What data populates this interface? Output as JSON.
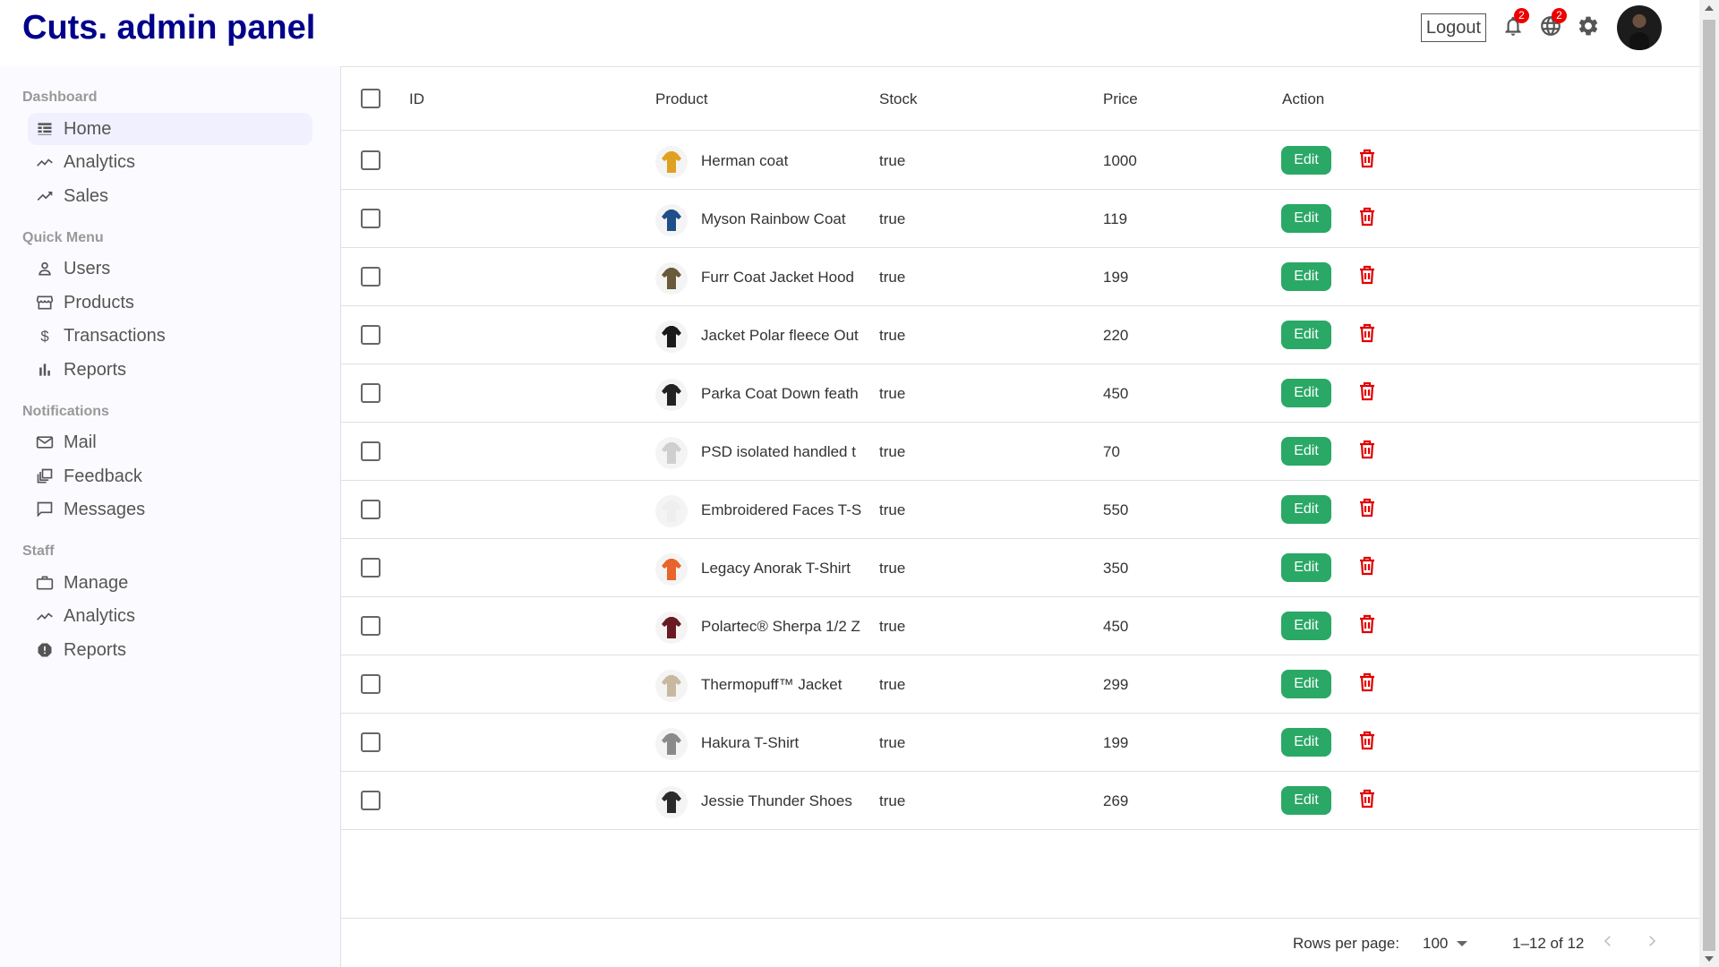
{
  "app": {
    "title": "Cuts. admin panel",
    "logout_label": "Logout",
    "notifications_count": "2",
    "language_count": "2",
    "icons": {
      "notifications": "bell-icon",
      "language": "globe-icon",
      "settings": "gear-icon"
    }
  },
  "colors": {
    "brand": "#00008b",
    "edit_button": "#2aa866",
    "delete_icon": "#e00000",
    "badge": "#ee0000",
    "active_nav_bg": "#f0f0ff"
  },
  "sidebar": {
    "sections": [
      {
        "title": "Dashboard",
        "items": [
          {
            "label": "Home",
            "icon": "dashboard-icon",
            "active": true
          },
          {
            "label": "Analytics",
            "icon": "timeline-icon"
          },
          {
            "label": "Sales",
            "icon": "trending-up-icon"
          }
        ]
      },
      {
        "title": "Quick Menu",
        "items": [
          {
            "label": "Users",
            "icon": "person-icon"
          },
          {
            "label": "Products",
            "icon": "storefront-icon"
          },
          {
            "label": "Transactions",
            "icon": "dollar-icon"
          },
          {
            "label": "Reports",
            "icon": "bar-chart-icon"
          }
        ]
      },
      {
        "title": "Notifications",
        "items": [
          {
            "label": "Mail",
            "icon": "mail-icon"
          },
          {
            "label": "Feedback",
            "icon": "dynamic-feed-icon"
          },
          {
            "label": "Messages",
            "icon": "chat-bubble-icon"
          }
        ]
      },
      {
        "title": "Staff",
        "items": [
          {
            "label": "Manage",
            "icon": "work-icon"
          },
          {
            "label": "Analytics",
            "icon": "timeline-icon"
          },
          {
            "label": "Reports",
            "icon": "report-icon"
          }
        ]
      }
    ]
  },
  "table": {
    "columns": {
      "id": "ID",
      "product": "Product",
      "stock": "Stock",
      "price": "Price",
      "action": "Action"
    },
    "edit_label": "Edit",
    "rows": [
      {
        "id": "",
        "product": "Herman coat",
        "stock": "true",
        "price": "1000",
        "thumb_color": "#e0a020"
      },
      {
        "id": "",
        "product": "Myson Rainbow Coat",
        "stock": "true",
        "price": "119",
        "thumb_color": "#1f4f8a"
      },
      {
        "id": "",
        "product": "Furr Coat Jacket Hood",
        "stock": "true",
        "price": "199",
        "thumb_color": "#6a5a3a"
      },
      {
        "id": "",
        "product": "Jacket Polar fleece Out",
        "stock": "true",
        "price": "220",
        "thumb_color": "#1a1a1a"
      },
      {
        "id": "",
        "product": "Parka Coat Down feath",
        "stock": "true",
        "price": "450",
        "thumb_color": "#222222"
      },
      {
        "id": "",
        "product": "PSD isolated handled t",
        "stock": "true",
        "price": "70",
        "thumb_color": "#cfcfcf"
      },
      {
        "id": "",
        "product": "Embroidered Faces T-S",
        "stock": "true",
        "price": "550",
        "thumb_color": "#eeeeee"
      },
      {
        "id": "",
        "product": "Legacy Anorak T-Shirt",
        "stock": "true",
        "price": "350",
        "thumb_color": "#e8642a"
      },
      {
        "id": "",
        "product": "Polartec® Sherpa 1/2 Z",
        "stock": "true",
        "price": "450",
        "thumb_color": "#6a1a22"
      },
      {
        "id": "",
        "product": "Thermopuff™ Jacket",
        "stock": "true",
        "price": "299",
        "thumb_color": "#c8b8a0"
      },
      {
        "id": "",
        "product": "Hakura T-Shirt",
        "stock": "true",
        "price": "199",
        "thumb_color": "#8a8a8a"
      },
      {
        "id": "",
        "product": "Jessie Thunder Shoes",
        "stock": "true",
        "price": "269",
        "thumb_color": "#2a2a2a"
      }
    ]
  },
  "pagination": {
    "rows_per_page_label": "Rows per page:",
    "rows_per_page_value": "100",
    "range_text": "1–12 of 12"
  }
}
